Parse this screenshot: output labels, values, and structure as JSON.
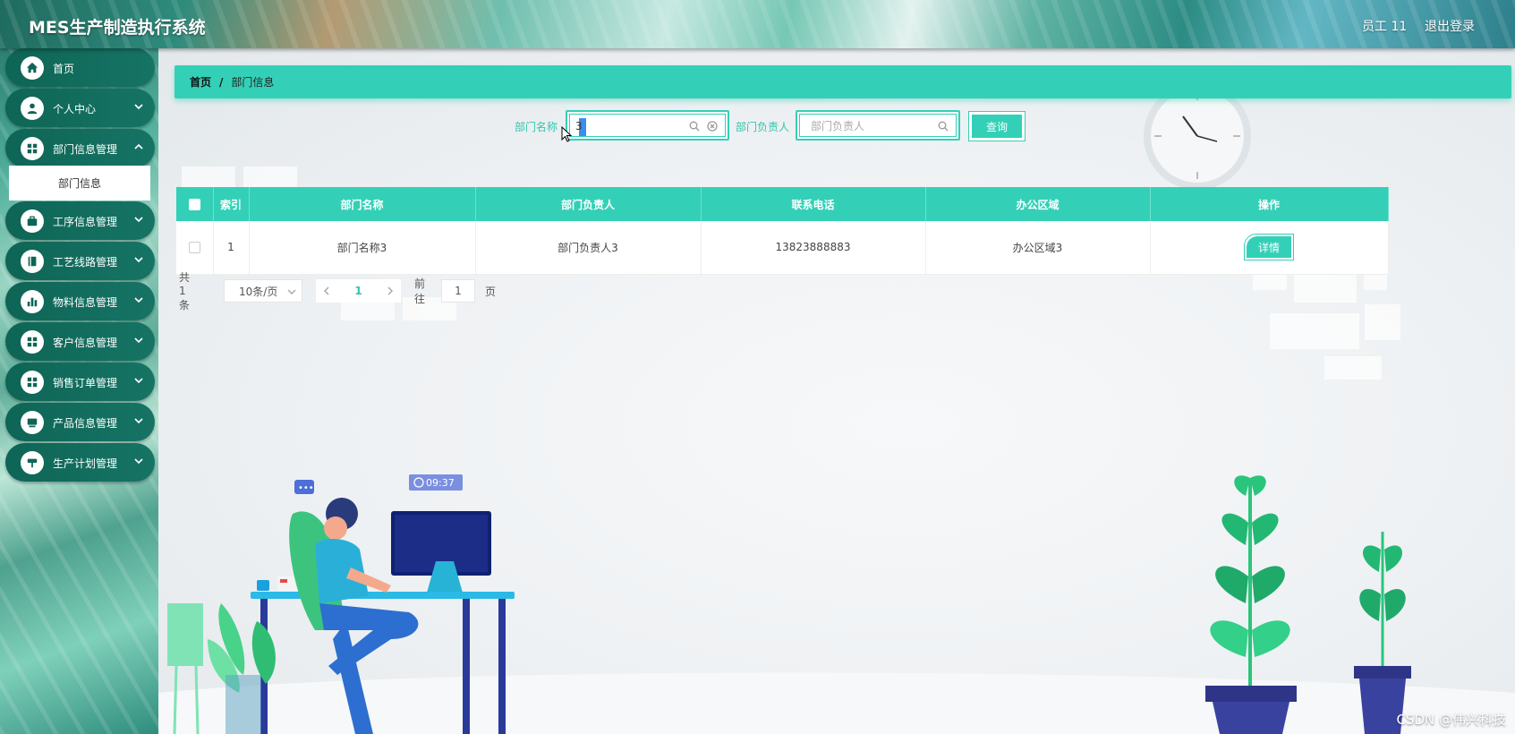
{
  "header": {
    "title": "MES生产制造执行系统",
    "user": "员工 11",
    "logout": "退出登录"
  },
  "sidebar": {
    "items": [
      {
        "label": "首页",
        "icon": "home-icon"
      },
      {
        "label": "个人中心",
        "icon": "user-icon"
      },
      {
        "label": "部门信息管理",
        "icon": "grid-icon"
      },
      {
        "label": "工序信息管理",
        "icon": "briefcase-icon"
      },
      {
        "label": "工艺线路管理",
        "icon": "book-icon"
      },
      {
        "label": "物料信息管理",
        "icon": "bar-chart-icon"
      },
      {
        "label": "客户信息管理",
        "icon": "grid-icon"
      },
      {
        "label": "销售订单管理",
        "icon": "grid-icon"
      },
      {
        "label": "产品信息管理",
        "icon": "monitor-icon"
      },
      {
        "label": "生产计划管理",
        "icon": "signpost-icon"
      }
    ],
    "submenu": {
      "label": "部门信息"
    }
  },
  "breadcrumb": {
    "home": "首页",
    "separator": "/",
    "current": "部门信息"
  },
  "search": {
    "dept_name_label": "部门名称",
    "dept_name_value": "3",
    "dept_head_label": "部门负责人",
    "dept_head_placeholder": "部门负责人",
    "query_button": "查询"
  },
  "table": {
    "columns": [
      "索引",
      "部门名称",
      "部门负责人",
      "联系电话",
      "办公区域",
      "操作"
    ],
    "rows": [
      {
        "index": "1",
        "dept_name": "部门名称3",
        "dept_head": "部门负责人3",
        "phone": "13823888883",
        "area": "办公区域3",
        "action": "详情"
      }
    ]
  },
  "pagination": {
    "total": "共 1 条",
    "page_size": "10条/页",
    "current_page": "1",
    "goto_label": "前往",
    "goto_value": "1",
    "page_unit": "页"
  },
  "illustration": {
    "clock_badge": "09:37"
  },
  "watermark": "CSDN @伟兴科技",
  "colors": {
    "accent": "#33d0b7",
    "sidebar_item": "#0e6555"
  }
}
